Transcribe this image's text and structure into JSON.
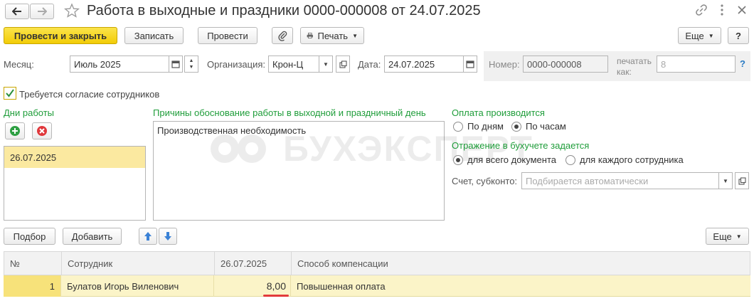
{
  "window": {
    "title": "Работа в выходные и праздники 0000-000008 от 24.07.2025"
  },
  "toolbar": {
    "post_close": "Провести и закрыть",
    "save": "Записать",
    "post": "Провести",
    "print": "Печать",
    "more": "Еще",
    "help": "?"
  },
  "header": {
    "month_label": "Месяц:",
    "month_value": "Июль 2025",
    "org_label": "Организация:",
    "org_value": "Крон-Ц",
    "date_label": "Дата:",
    "date_value": "24.07.2025",
    "number_label": "Номер:",
    "number_value": "0000-000008",
    "print_as_label_1": "печатать",
    "print_as_label_2": "как:",
    "print_as_value": "8",
    "print_as_help": "?"
  },
  "consent": {
    "checked": true,
    "label": "Требуется согласие сотрудников"
  },
  "work_days": {
    "title": "Дни работы",
    "items": [
      "26.07.2025"
    ]
  },
  "reasons": {
    "title": "Причины обоснование работы в выходной и праздничный день",
    "text": "Производственная необходимость"
  },
  "payment": {
    "title": "Оплата производится",
    "options": [
      {
        "label": "По дням",
        "selected": false
      },
      {
        "label": "По часам",
        "selected": true
      }
    ]
  },
  "accounting": {
    "title": "Отражение в бухучете задается",
    "options": [
      {
        "label": "для всего документа",
        "selected": true
      },
      {
        "label": "для каждого сотрудника",
        "selected": false
      }
    ],
    "account_label": "Счет, субконто:",
    "account_placeholder": "Подбирается автоматически"
  },
  "table_toolbar": {
    "pick": "Подбор",
    "add": "Добавить",
    "more": "Еще"
  },
  "table": {
    "columns": [
      "№",
      "Сотрудник",
      "26.07.2025",
      "Способ компенсации"
    ],
    "rows": [
      {
        "num": "1",
        "employee": "Булатов Игорь Виленович",
        "hours": "8,00",
        "compensation": "Повышенная оплата"
      }
    ]
  },
  "watermark": "БУХЭКСПЕРТ",
  "colors": {
    "accent_yellow": "#f5d00c",
    "section_green": "#1f9d3a",
    "row_highlight": "#fbf4c8",
    "underline_red": "#e23b3b"
  }
}
